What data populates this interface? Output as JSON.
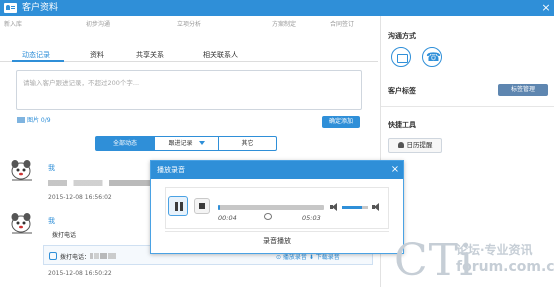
{
  "window": {
    "title": "客户资料",
    "close_glyph": "×"
  },
  "steps": [
    "新入库",
    "初步沟通",
    "立项分析",
    "方案制定",
    "合同签订"
  ],
  "tabs": [
    "动态记录",
    "资料",
    "共享关系",
    "相关联系人"
  ],
  "note": {
    "placeholder": "请输入客户跟进记录，不超过200个字..."
  },
  "pictures": {
    "label": "图片 0/9"
  },
  "add_button": "确定添加",
  "filter": {
    "all": "全部动态",
    "followup": "跟进记录",
    "other": "其它"
  },
  "entries": [
    {
      "name": "我",
      "time": "2015-12-08 16:56:02"
    },
    {
      "name": "我",
      "action": "拨打电话",
      "call_label": "拨打电话：",
      "time": "2015-12-08 16:50:22",
      "actions": "⊙ 播放录音   ⬇ 下载录音"
    }
  ],
  "sidebar": {
    "contact_title": "沟通方式",
    "tags_title": "客户标签",
    "tag_button": "标签管理",
    "tools_title": "快捷工具",
    "reminder_button": "日历提醒"
  },
  "dialog": {
    "title": "播放录音",
    "close_glyph": "×",
    "current_time": "00:04",
    "total_time": "05:03",
    "progress": 0.02,
    "volume": 0.75,
    "footer": "录音播放"
  },
  "watermark": {
    "letters": "CTi",
    "cn": "论坛·专业资讯",
    "forum": "forum.com.cn"
  },
  "colors": {
    "accent": "#2f8fd8",
    "header": "#2f8fd8",
    "tag_button": "#5e86b0"
  }
}
